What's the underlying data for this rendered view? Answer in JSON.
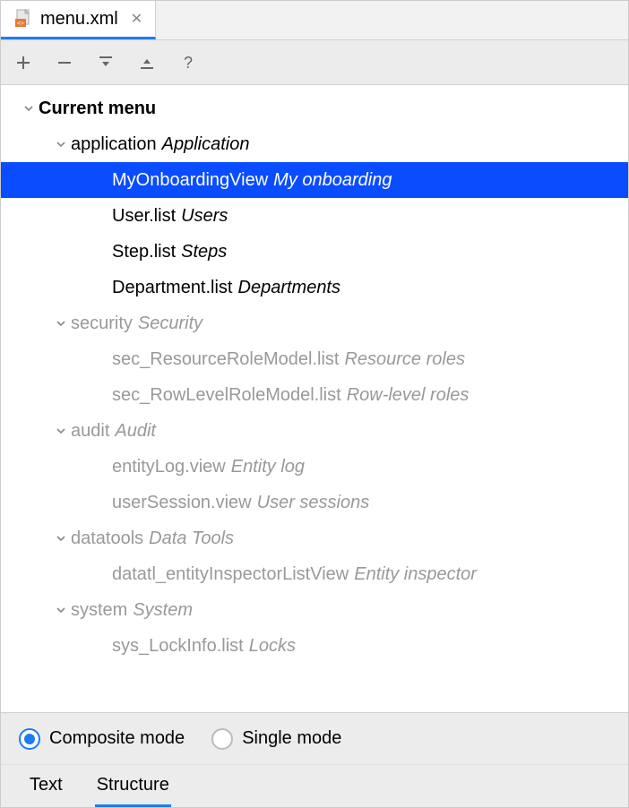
{
  "tab": {
    "filename": "menu.xml"
  },
  "tree": {
    "root": {
      "label": "Current menu"
    },
    "groups": [
      {
        "id": "application",
        "label": "Application",
        "dim": false,
        "items": [
          {
            "id": "MyOnboardingView",
            "label": "My onboarding",
            "selected": true,
            "dim": false
          },
          {
            "id": "User.list",
            "label": "Users",
            "dim": false
          },
          {
            "id": "Step.list",
            "label": "Steps",
            "dim": false
          },
          {
            "id": "Department.list",
            "label": "Departments",
            "dim": false
          }
        ]
      },
      {
        "id": "security",
        "label": "Security",
        "dim": true,
        "items": [
          {
            "id": "sec_ResourceRoleModel.list",
            "label": "Resource roles",
            "dim": true
          },
          {
            "id": "sec_RowLevelRoleModel.list",
            "label": "Row-level roles",
            "dim": true
          }
        ]
      },
      {
        "id": "audit",
        "label": "Audit",
        "dim": true,
        "items": [
          {
            "id": "entityLog.view",
            "label": "Entity log",
            "dim": true
          },
          {
            "id": "userSession.view",
            "label": "User sessions",
            "dim": true
          }
        ]
      },
      {
        "id": "datatools",
        "label": "Data Tools",
        "dim": true,
        "items": [
          {
            "id": "datatl_entityInspectorListView",
            "label": "Entity inspector",
            "dim": true
          }
        ]
      },
      {
        "id": "system",
        "label": "System",
        "dim": true,
        "items": [
          {
            "id": "sys_LockInfo.list",
            "label": "Locks",
            "dim": true
          }
        ]
      }
    ]
  },
  "mode": {
    "composite": "Composite mode",
    "single": "Single mode",
    "selected": "composite"
  },
  "bottom_tabs": {
    "text": "Text",
    "structure": "Structure",
    "active": "structure"
  }
}
